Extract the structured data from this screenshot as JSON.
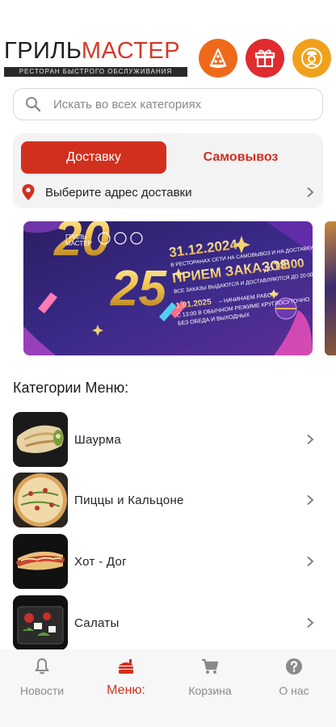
{
  "header": {
    "logo_part1": "ГРИЛЬ",
    "logo_part2": "МАСТЕР",
    "logo_subtitle": "РЕСТОРАН БЫСТРОГО ОБСЛУЖИВАНИЯ",
    "icons": [
      "pizza-icon",
      "gift-box-icon",
      "chef-icon"
    ]
  },
  "search": {
    "placeholder": "Искать во всех категориях"
  },
  "delivery": {
    "delivery_label": "Доставку",
    "pickup_label": "Самовывоз",
    "address_prompt": "Выберите адрес доставки"
  },
  "banner": {
    "logo_line1": "ГРИЛЬ",
    "logo_line2": "МАСТЕР",
    "year_a": "20",
    "year_b": "25",
    "date1": "31.12.2024",
    "line1": "В РЕСТОРАНАХ СЕТИ НА САМОВЫВОЗ И НА ДОСТАВКУ",
    "line2": "ПРИЕМ ЗАКАЗОВ",
    "line2_small": "ДО",
    "line2_time": "18:00",
    "line3": "ВСЕ ЗАКАЗЫ ВЫДАЮТСЯ И ДОСТАВЛЯЮТСЯ ДО 20:00!",
    "date2": "1.01.2025",
    "line4": "– НАЧИНАЕМ РАБОТУ",
    "line5": "С 13:00 В ОБЫЧНОМ РЕЖИМЕ КРУГЛОСУТОЧНО",
    "line6": "БЕЗ ОБЕДА И ВЫХОДНЫХ"
  },
  "categories": {
    "title": "Категории Меню:",
    "items": [
      {
        "label": "Шаурма"
      },
      {
        "label": "Пиццы и Кальцоне"
      },
      {
        "label": "Хот - Дог"
      },
      {
        "label": "Салаты"
      }
    ]
  },
  "tabbar": {
    "tabs": [
      {
        "label": "Новости",
        "icon": "bell-icon",
        "active": false
      },
      {
        "label": "Меню:",
        "icon": "menu-food-icon",
        "active": true
      },
      {
        "label": "Корзина",
        "icon": "cart-icon",
        "active": false
      },
      {
        "label": "О нас",
        "icon": "help-icon",
        "active": false
      }
    ]
  },
  "colors": {
    "accent": "#d2301f",
    "pizza_icon_bg": "#ee6a1a",
    "box_icon_bg": "#e02b2f",
    "chef_icon_bg": "#f0a11c",
    "tab_inactive": "#8a8a8a"
  }
}
